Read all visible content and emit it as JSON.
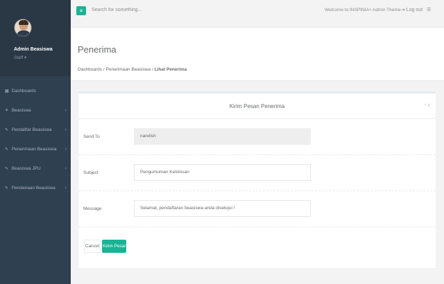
{
  "sidebar": {
    "profile": {
      "name": "Admin Beasiswa",
      "role": "Staff ▾"
    },
    "items": [
      {
        "icon": "▦",
        "label": "Dashboards",
        "arrow": ""
      },
      {
        "icon": "⚘",
        "label": "Beasiswa",
        "arrow": "‹"
      },
      {
        "icon": "✎",
        "label": "Pendaftar Beasiswa",
        "arrow": "‹"
      },
      {
        "icon": "✎",
        "label": "Penerimaan Beasiswa",
        "arrow": "‹"
      },
      {
        "icon": "✎",
        "label": "Beasiswa JPU",
        "arrow": "‹"
      },
      {
        "icon": "✎",
        "label": "Pendanaan Beasiswa",
        "arrow": "‹"
      }
    ]
  },
  "topbar": {
    "menu_icon": "≡",
    "search_placeholder": "Search for something...",
    "welcome": "Welcome to INSPINIA+ Admin Theme.",
    "logout": "⇥ Log out",
    "more_icon": "☰"
  },
  "heading": {
    "title": "Penerima",
    "breadcrumb": {
      "item1": "Dashboards",
      "sep": "/",
      "item2": "Penerimaan Beasiswa",
      "active": "Lihat Penerima"
    }
  },
  "panel": {
    "title": "Kirim Pesan Penerima",
    "tools": "^ X",
    "fields": {
      "send_to": {
        "label": "Send To",
        "value": "nandish"
      },
      "subject": {
        "label": "Subject",
        "value": "Pengumuman Kelolosan"
      },
      "message": {
        "label": "Message",
        "value": "Selamat, pendaftaran beasiswa anda disetujui !"
      }
    },
    "buttons": {
      "cancel": "Cancel",
      "send": "Kirim Pesan"
    }
  },
  "colors": {
    "sidebar": "#2f4050",
    "accent": "#1ab394",
    "background": "#f3f3f4"
  }
}
